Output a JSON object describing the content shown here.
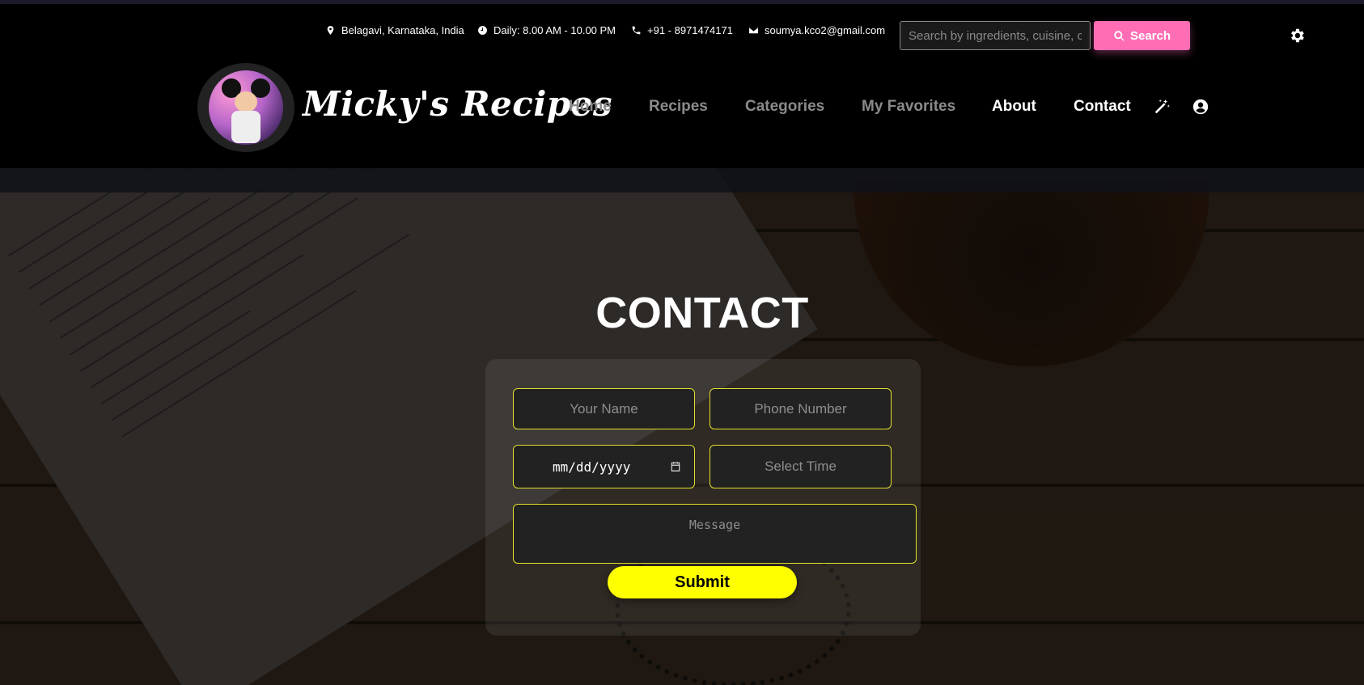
{
  "topbar": {
    "location": "Belagavi, Karnataka, India",
    "hours": "Daily: 8.00 AM - 10.00 PM",
    "phone": "+91 - 8971474171",
    "email": "soumya.kco2@gmail.com",
    "search_placeholder": "Search by ingredients, cuisine, c",
    "search_label": "Search"
  },
  "brand": {
    "name": "Micky's Recipes"
  },
  "nav": {
    "home": "Home",
    "recipes": "Recipes",
    "categories": "Categories",
    "favorites": "My Favorites",
    "about": "About",
    "contact": "Contact"
  },
  "contact": {
    "title": "CONTACT",
    "name_placeholder": "Your Name",
    "phone_placeholder": "Phone Number",
    "date_value": "mm/dd/yyyy",
    "time_placeholder": "Select Time",
    "message_placeholder": "Message",
    "submit_label": "Submit"
  },
  "colors": {
    "accent_pink": "#ff6eb4",
    "accent_yellow": "#ffff00",
    "field_border": "#e2df2c"
  },
  "icons": [
    "map-pin-icon",
    "clock-icon",
    "phone-icon",
    "envelope-icon",
    "search-icon",
    "gear-icon",
    "magic-wand-icon",
    "user-circle-icon",
    "calendar-icon"
  ]
}
